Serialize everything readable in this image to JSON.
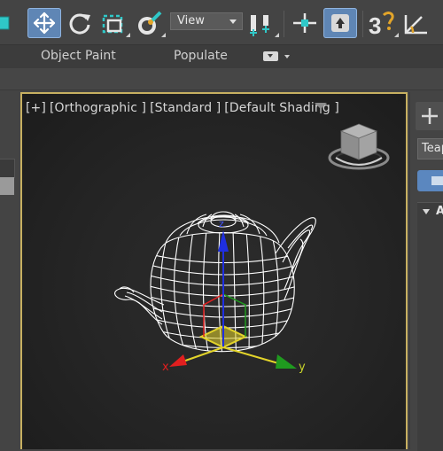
{
  "toolbar": {
    "view_dropdown": "View",
    "buttons": [
      "select-and-move",
      "rotate",
      "select-region",
      "paint-selection",
      "view-coordinate-system",
      "pivot-center",
      "select-manipulate",
      "keyboard-shortcut-override",
      "3d-snap",
      "angle-snap"
    ]
  },
  "ribbon": {
    "tabs": [
      "Object Paint",
      "Populate"
    ]
  },
  "viewport": {
    "label_parts": [
      "[+]",
      "[Orthographic ]",
      "[Standard ]",
      "[Default Shading ]"
    ],
    "object": "teapot",
    "gizmo_axes": [
      "x",
      "y",
      "z"
    ],
    "colors": {
      "border": "#c7b061",
      "x_axis": "#e11f1f",
      "y_axis": "#1f9a1f",
      "z_axis": "#1f2fe0",
      "gizmo_plane": "#e3d42a"
    }
  },
  "command_panel": {
    "object_name": "Teap",
    "rollout_label": "A"
  },
  "icons": {
    "add": "plus-icon",
    "filter": "filter-icon",
    "viewcube": "viewcube-icon"
  }
}
